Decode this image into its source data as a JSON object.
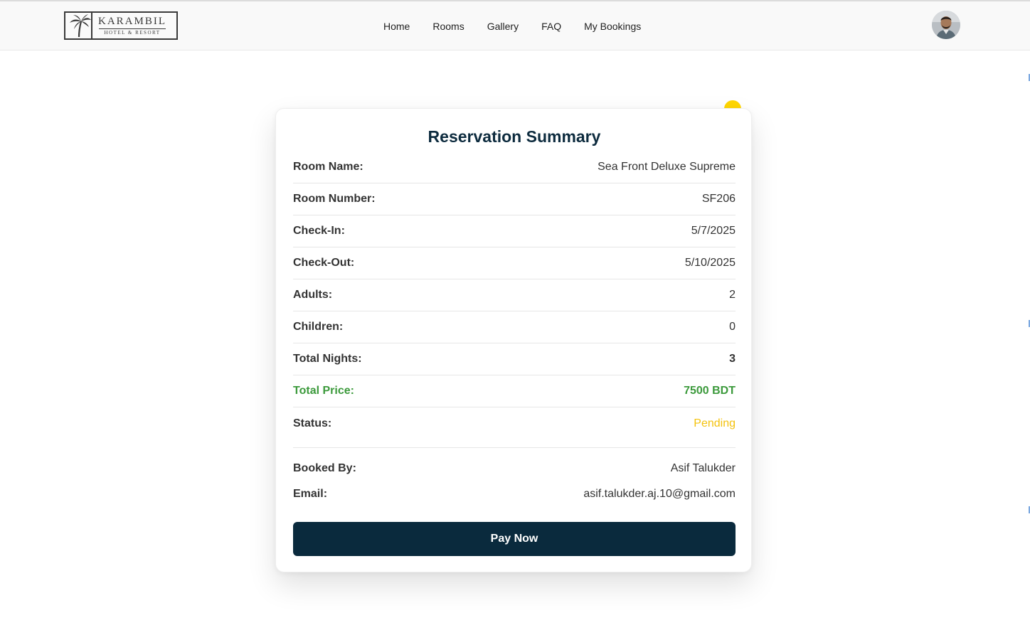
{
  "brand": {
    "name": "KARAMBIL",
    "tagline": "HOTEL & RESORT"
  },
  "nav": {
    "links": [
      "Home",
      "Rooms",
      "Gallery",
      "FAQ",
      "My Bookings"
    ]
  },
  "summary": {
    "title": "Reservation Summary",
    "room_name": {
      "label": "Room Name:",
      "value": "Sea Front Deluxe Supreme"
    },
    "room_number": {
      "label": "Room Number:",
      "value": "SF206"
    },
    "check_in": {
      "label": "Check-In:",
      "value": "5/7/2025"
    },
    "check_out": {
      "label": "Check-Out:",
      "value": "5/10/2025"
    },
    "adults": {
      "label": "Adults:",
      "value": "2"
    },
    "children": {
      "label": "Children:",
      "value": "0"
    },
    "total_nights": {
      "label": "Total Nights:",
      "value": "3"
    },
    "total_price": {
      "label": "Total Price:",
      "value": "7500 BDT"
    },
    "status": {
      "label": "Status:",
      "value": "Pending"
    },
    "booked_by": {
      "label": "Booked By:",
      "value": "Asif Talukder"
    },
    "email": {
      "label": "Email:",
      "value": "asif.talukder.aj.10@gmail.com"
    },
    "pay_button": "Pay Now"
  },
  "colors": {
    "primary": "#0a2a3d",
    "price_green": "#3c9a3c",
    "status_pending": "#f4c20d",
    "status_dot": "#ffd600"
  },
  "icons": {
    "logo": "palm-tree-logo",
    "avatar": "user-avatar",
    "status_indicator": "status-dot"
  }
}
